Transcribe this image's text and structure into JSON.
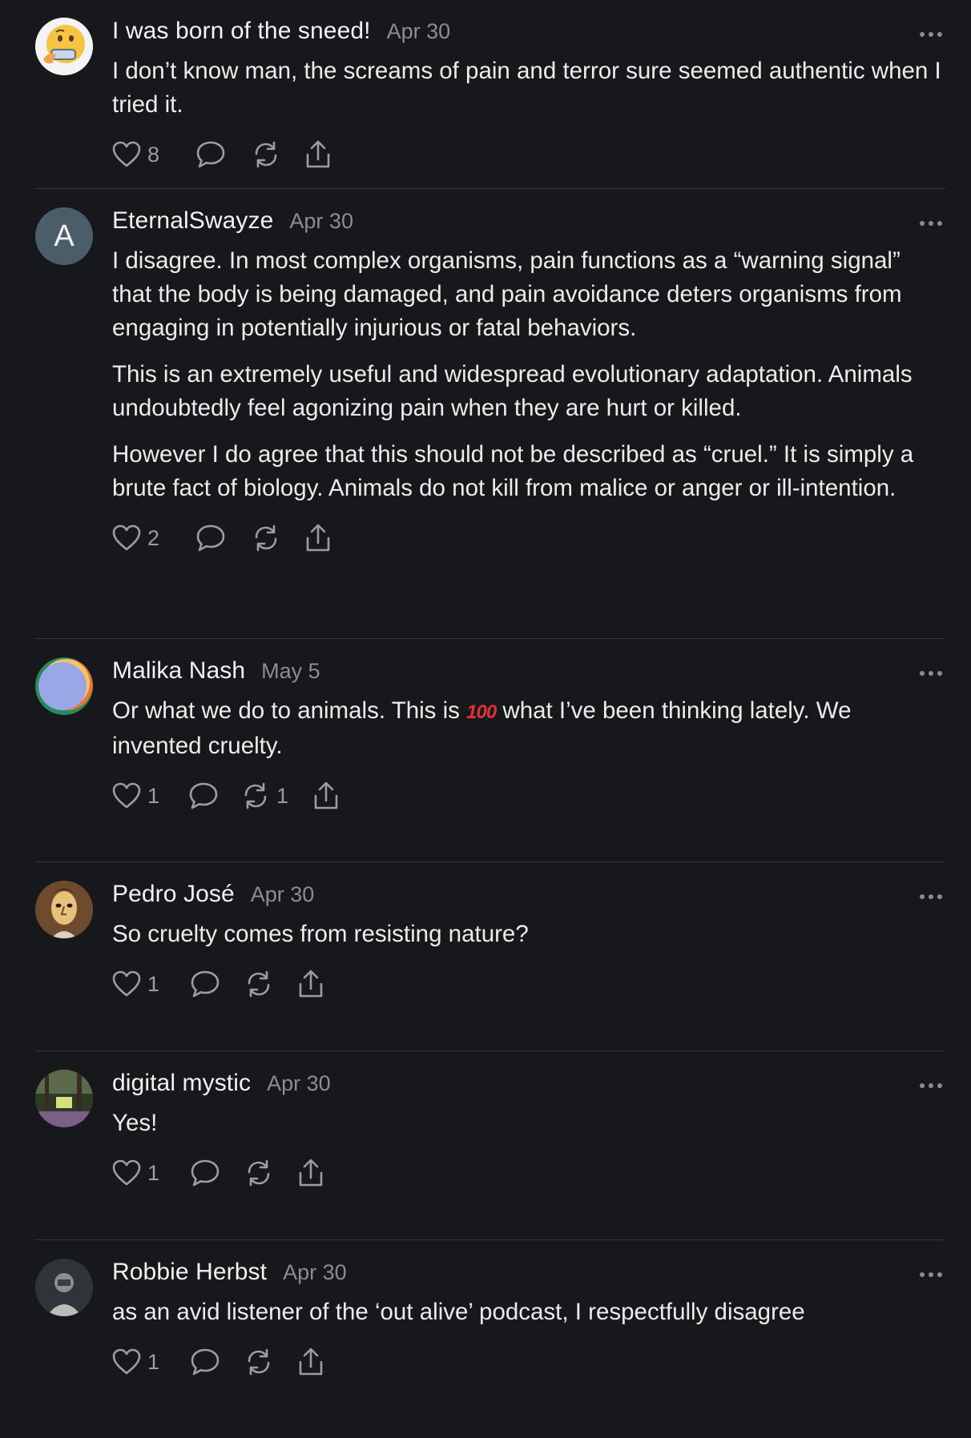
{
  "posts": [
    {
      "author": "I was born of the sneed!",
      "date": "Apr 30",
      "avatar": "thinking-face-emoji",
      "paragraphs": [
        "I don’t know man, the screams of pain and terror sure seemed authentic when I tried it."
      ],
      "likes": "8",
      "reposts": ""
    },
    {
      "author": "EternalSwayze",
      "date": "Apr 30",
      "avatar": "letter-A",
      "avatar_letter": "A",
      "paragraphs": [
        "I disagree. In most complex organisms, pain functions as a “warning signal” that the body is being damaged, and pain avoidance deters organisms from engaging in potentially injurious or fatal behaviors.",
        "This is an extremely useful and widespread evolutionary adaptation. Animals undoubtedly feel agonizing pain when they are hurt or killed.",
        "However I do agree that this should not be described as “cruel.” It is simply a brute fact of biology. Animals do not kill from malice or anger or ill-intention."
      ],
      "likes": "2",
      "reposts": ""
    },
    {
      "author": "Malika Nash",
      "date": "May 5",
      "avatar": "gradient-circle",
      "paragraph_parts": [
        "Or what we do to animals. This is ",
        "100",
        " what I’ve been thinking lately. We invented cruelty."
      ],
      "likes": "1",
      "reposts": "1"
    },
    {
      "author": "Pedro José",
      "date": "Apr 30",
      "avatar": "painted-portrait",
      "paragraphs": [
        "So cruelty comes from resisting nature?"
      ],
      "likes": "1",
      "reposts": ""
    },
    {
      "author": "digital mystic",
      "date": "Apr 30",
      "avatar": "forest-photo",
      "paragraphs": [
        "Yes!"
      ],
      "likes": "1",
      "reposts": ""
    },
    {
      "author": "Robbie Herbst",
      "date": "Apr 30",
      "avatar": "person-photo",
      "paragraphs": [
        "as an avid listener of the ‘out alive’ podcast, I respectfully disagree"
      ],
      "likes": "1",
      "reposts": ""
    }
  ]
}
